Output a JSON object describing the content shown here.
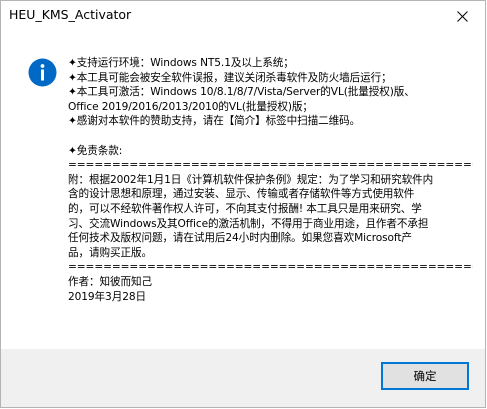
{
  "window": {
    "title": "HEU_KMS_Activator"
  },
  "dialog": {
    "lines": [
      "✦支持运行环境：Windows NT5.1及以上系统；",
      "✦本工具可能会被安全软件误报，建议关闭杀毒软件及防火墙后运行；",
      "✦本工具可激活：Windows 10/8.1/8/7/Vista/Server的VL(批量授权)版、",
      "Office 2019/2016/2013/2010的VL(批量授权)版；",
      "✦感谢对本软件的赞助支持，请在【简介】标签中扫描二维码。",
      "",
      "✦免责条款:",
      "================================================",
      "附：根据2002年1月1日《计算机软件保护条例》规定：为了学习和研究软件内",
      "含的设计思想和原理，通过安装、显示、传输或者存储软件等方式使用软件",
      "的，可以不经软件著作权人许可，不向其支付报酬! 本工具只是用来研究、学",
      "习、交流Windows及其Office的激活机制，不得用于商业用途，且作者不承担",
      "任何技术及版权问题，请在试用后24小时内删除。如果您喜欢Microsoft产",
      "品，请购买正版。",
      "================================================",
      "作者：知彼而知己",
      " 2019年3月28日"
    ]
  },
  "buttons": {
    "ok_label": "确定"
  },
  "icons": {
    "info": "info-icon",
    "close": "close-icon"
  },
  "colors": {
    "info_icon": "#0068c5",
    "button_border": "#0078d7",
    "footer_bg": "#f0f0f0"
  }
}
